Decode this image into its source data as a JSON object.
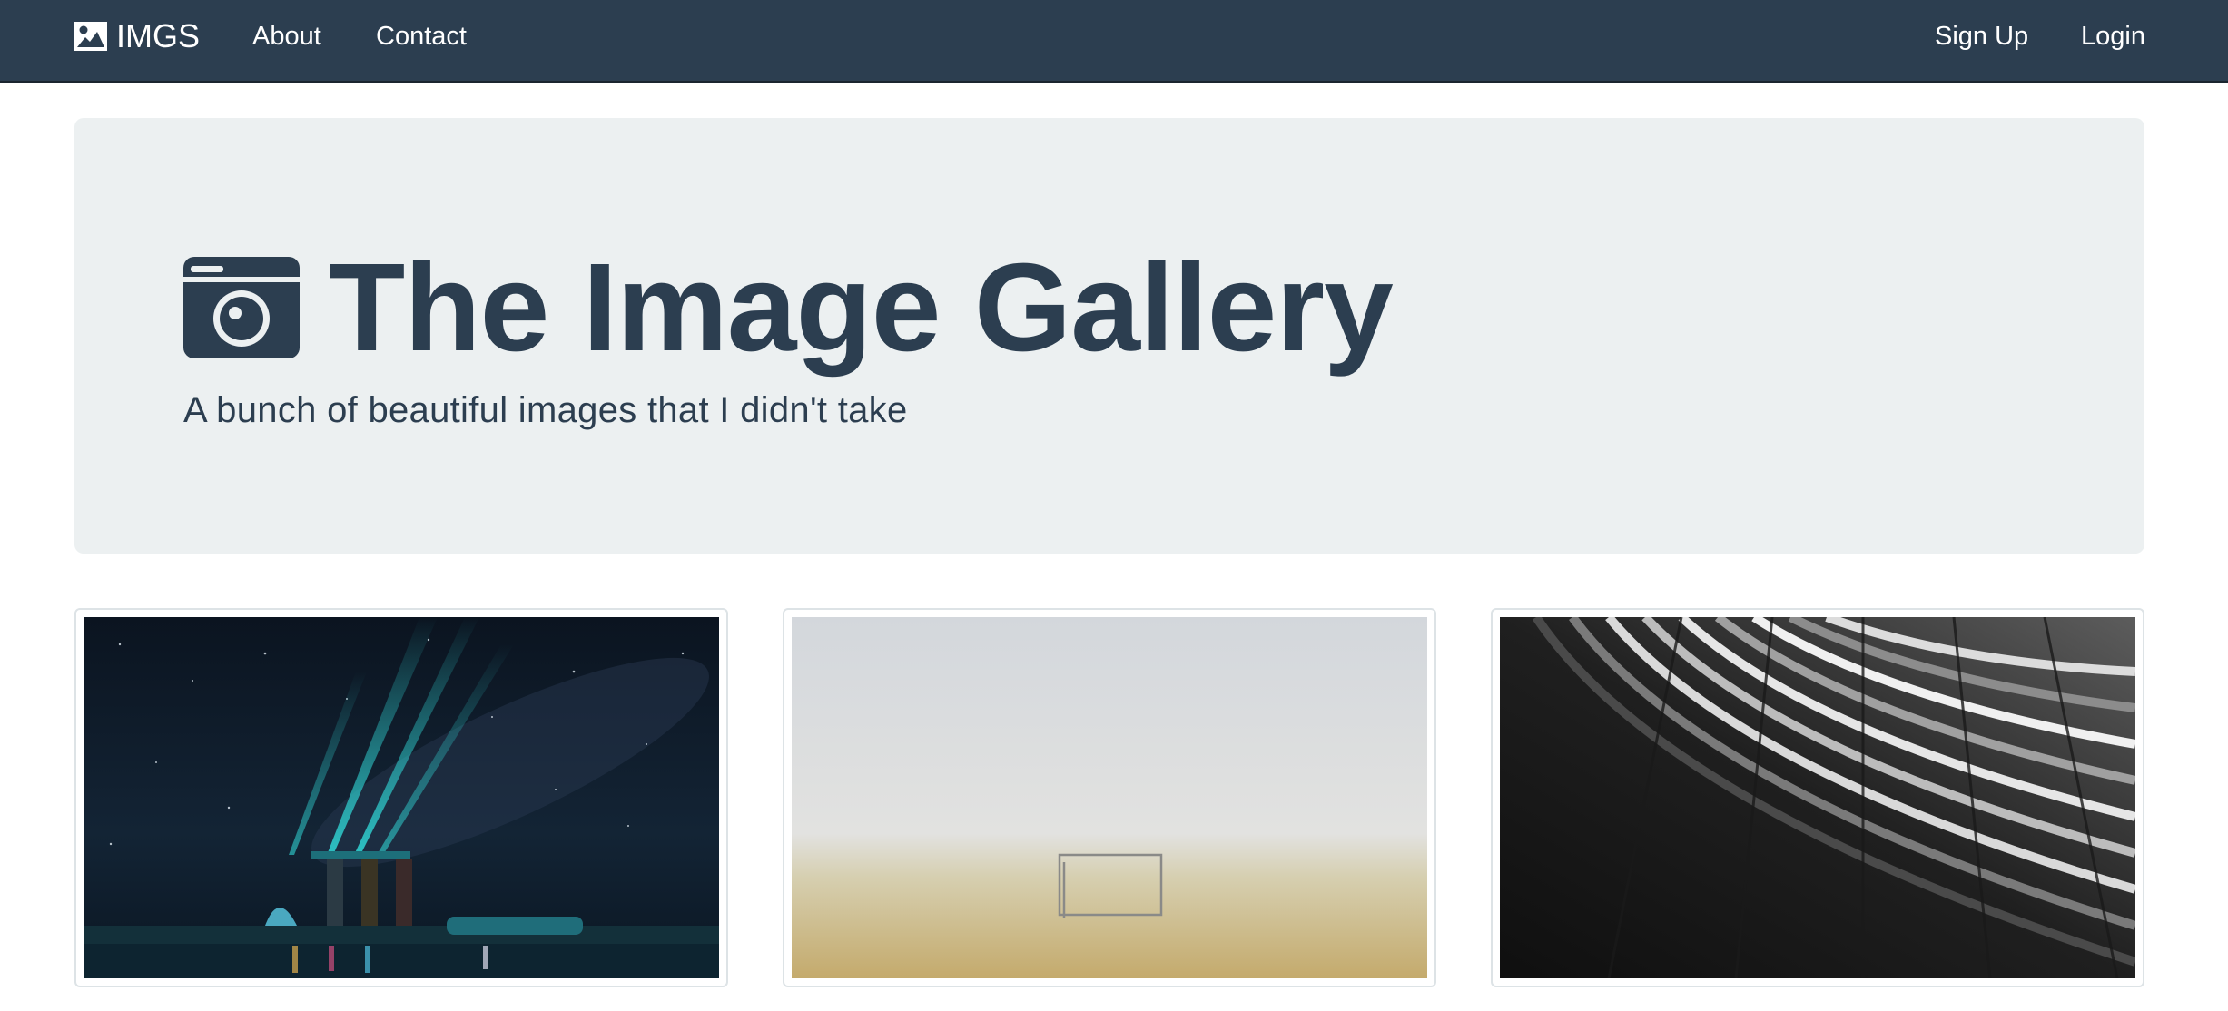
{
  "navbar": {
    "brand": "IMGS",
    "brand_icon": "picture-icon",
    "links": {
      "about": "About",
      "contact": "Contact",
      "signup": "Sign Up",
      "login": "Login"
    },
    "background": "#2c3e50"
  },
  "jumbotron": {
    "title_icon": "camera-icon",
    "title": "The Image Gallery",
    "subtitle": "A bunch of beautiful images that I didn't take",
    "background": "#ecf0f1",
    "text_color": "#2c3e50"
  },
  "gallery": {
    "images": [
      "night-skyline-photo",
      "foggy-field-goal-photo",
      "abstract-architecture-photo"
    ]
  }
}
